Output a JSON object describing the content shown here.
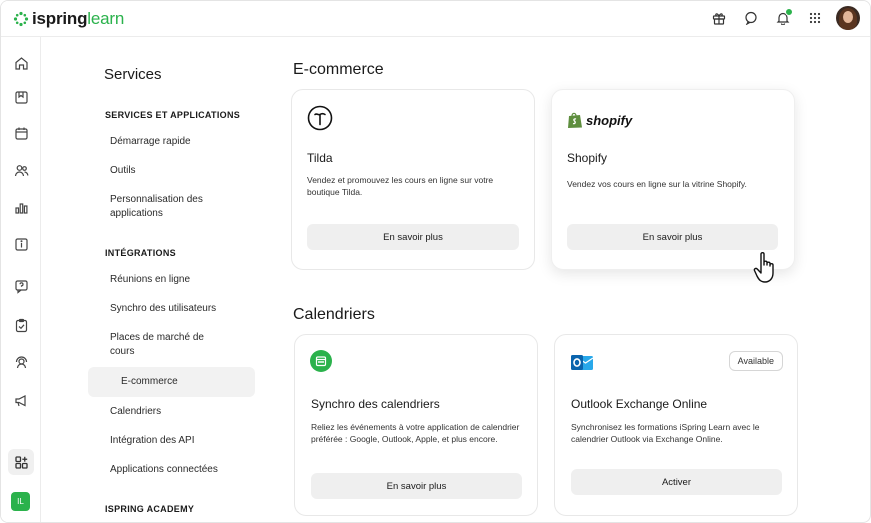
{
  "app": {
    "logo_bold": "ispring",
    "logo_light": "learn",
    "brand_color": "#2bb24c"
  },
  "topbar": {
    "icons": [
      "gift-icon",
      "chat-icon",
      "bell-icon",
      "apps-grid-icon",
      "avatar"
    ]
  },
  "rail": {
    "icons": [
      "home-icon",
      "courses-icon",
      "calendar-icon",
      "users-icon",
      "reports-icon",
      "news-icon",
      "feedback-icon",
      "tasks-icon",
      "mentors-icon",
      "announcements-icon",
      "services-icon"
    ],
    "user_initials": "IL"
  },
  "nav": {
    "title": "Services",
    "sections": [
      {
        "label": "SERVICES ET APPLICATIONS",
        "items": [
          "Démarrage rapide",
          "Outils",
          "Personnalisation des applications"
        ]
      },
      {
        "label": "INTÉGRATIONS",
        "items": [
          "Réunions en ligne",
          "Synchro des utilisateurs",
          "Places de marché de cours",
          "E-commerce",
          "Calendriers",
          "Intégration des API",
          "Applications connectées"
        ]
      },
      {
        "label": "ISPRING ACADEMY",
        "items": []
      }
    ],
    "active_item": "E-commerce"
  },
  "main": {
    "ecommerce": {
      "heading": "E-commerce",
      "cards": [
        {
          "logo": "tilda-logo",
          "title": "Tilda",
          "description": "Vendez et promouvez les cours en ligne sur votre boutique Tilda.",
          "button": "En savoir plus"
        },
        {
          "logo": "shopify-logo",
          "logo_text": "shopify",
          "title": "Shopify",
          "description": "Vendez vos cours en ligne sur la vitrine Shopify.",
          "button": "En savoir plus"
        }
      ]
    },
    "calendars": {
      "heading": "Calendriers",
      "cards": [
        {
          "logo": "calendar-sync-icon",
          "title": "Synchro des calendriers",
          "description": "Reliez les événements à votre application de calendrier préférée : Google, Outlook, Apple, et plus encore.",
          "button": "En savoir plus"
        },
        {
          "logo": "outlook-logo",
          "badge": "Available",
          "title": "Outlook Exchange Online",
          "description": "Synchronisez les formations iSpring Learn avec le calendrier Outlook via Exchange Online.",
          "button": "Activer"
        }
      ]
    }
  }
}
